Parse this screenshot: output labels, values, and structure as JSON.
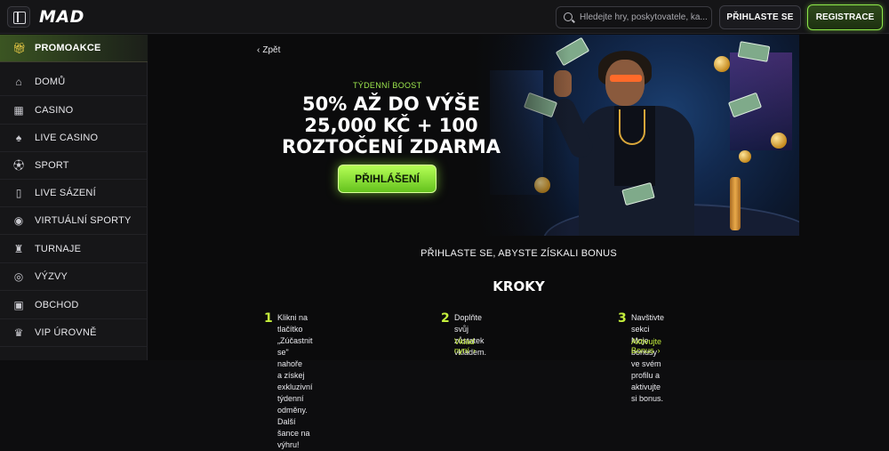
{
  "header": {
    "logo": "MAD",
    "search_placeholder": "Hledejte hry, poskytovatele, ka...",
    "login_label": "PŘIHLASTE SE",
    "register_label": "REGISTRACE"
  },
  "sidebar": {
    "items": [
      {
        "label": "PROMOAKCE",
        "icon": "gift-icon"
      },
      {
        "label": "DOMŮ",
        "icon": "home-icon"
      },
      {
        "label": "CASINO",
        "icon": "slot-machine-icon"
      },
      {
        "label": "LIVE CASINO",
        "icon": "cards-icon"
      },
      {
        "label": "SPORT",
        "icon": "soccer-ball-icon"
      },
      {
        "label": "LIVE SÁZENÍ",
        "icon": "phone-icon"
      },
      {
        "label": "VIRTUÁLNÍ SPORTY",
        "icon": "gamepad-icon"
      },
      {
        "label": "TURNAJE",
        "icon": "trophy-icon"
      },
      {
        "label": "VÝZVY",
        "icon": "medal-icon"
      },
      {
        "label": "OBCHOD",
        "icon": "shopping-bag-icon"
      },
      {
        "label": "VIP ÚROVNĚ",
        "icon": "crown-icon"
      }
    ]
  },
  "main": {
    "back_label": "Zpět",
    "promo": {
      "kicker": "TÝDENNÍ BOOST",
      "title": "50% AŽ DO VÝŠE 25,000 KČ + 100 ROZTOČENÍ ZDARMA",
      "button_label": "PŘIHLÁŠENÍ"
    },
    "subhead": "PŘIHLASTE SE, ABYSTE ZÍSKALI BONUS",
    "steps_title": "KROKY",
    "steps": [
      {
        "number": "1",
        "text": "Klikni na tlačítko „Zúčastnit se\" nahoře\na získej exkluzivní týdenní odměny.\nDalší šance na výhru!",
        "link": ""
      },
      {
        "number": "2",
        "text": "Doplňte svůj zůstatek vkladem.",
        "link": "Vklad nyní"
      },
      {
        "number": "3",
        "text": "Navštivte sekci Moje bonusy ve svém\nprofilu a aktivujte si bonus.",
        "link": "Aktivujte Bonus"
      }
    ]
  },
  "colors": {
    "accent_green": "#c4ef3c",
    "button_green": "#8ee84a",
    "background": "#0d0d0f"
  }
}
